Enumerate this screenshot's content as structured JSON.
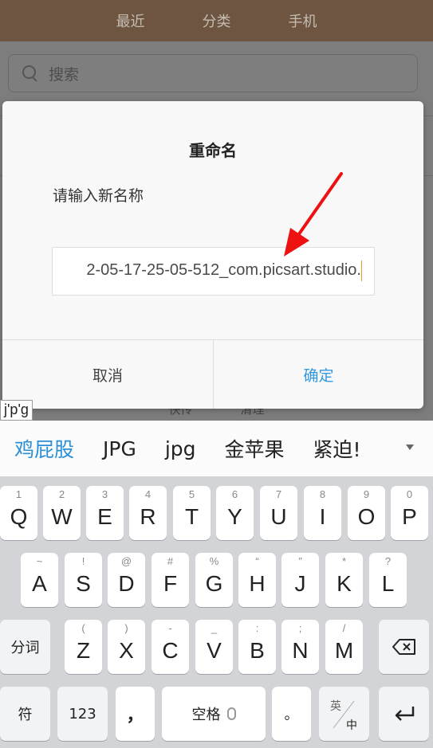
{
  "topbar": {
    "tabs": [
      "最近",
      "分类",
      "手机"
    ]
  },
  "search": {
    "placeholder": "搜索"
  },
  "background": {
    "bottom_labels": [
      "快传",
      "清理"
    ]
  },
  "dialog": {
    "title": "重命名",
    "prompt": "请输入新名称",
    "input_value": "2-05-17-25-05-512_com.picsart.studio.",
    "cancel_label": "取消",
    "ok_label": "确定"
  },
  "ime": {
    "composition": "j'p'g",
    "candidates": [
      "鸡屁股",
      "JPG",
      "jpg",
      "金苹果",
      "紧迫!"
    ]
  },
  "keyboard": {
    "row1": [
      {
        "main": "Q",
        "sub": "1"
      },
      {
        "main": "W",
        "sub": "2"
      },
      {
        "main": "E",
        "sub": "3"
      },
      {
        "main": "R",
        "sub": "4"
      },
      {
        "main": "T",
        "sub": "5"
      },
      {
        "main": "Y",
        "sub": "6"
      },
      {
        "main": "U",
        "sub": "7"
      },
      {
        "main": "I",
        "sub": "8"
      },
      {
        "main": "O",
        "sub": "9"
      },
      {
        "main": "P",
        "sub": "0"
      }
    ],
    "row2": [
      {
        "main": "A",
        "sub": "~"
      },
      {
        "main": "S",
        "sub": "!"
      },
      {
        "main": "D",
        "sub": "@"
      },
      {
        "main": "F",
        "sub": "#"
      },
      {
        "main": "G",
        "sub": "%"
      },
      {
        "main": "H",
        "sub": "“"
      },
      {
        "main": "J",
        "sub": "”"
      },
      {
        "main": "K",
        "sub": "*"
      },
      {
        "main": "L",
        "sub": "?"
      }
    ],
    "row3": [
      {
        "main": "Z",
        "sub": "("
      },
      {
        "main": "X",
        "sub": ")"
      },
      {
        "main": "C",
        "sub": "-"
      },
      {
        "main": "V",
        "sub": "_"
      },
      {
        "main": "B",
        "sub": ":"
      },
      {
        "main": "N",
        "sub": ";"
      },
      {
        "main": "M",
        "sub": "/"
      }
    ],
    "segment_label": "分词",
    "symbol_label": "符",
    "number_label": "123",
    "comma_label": "，",
    "space_label": "空格",
    "period_label": "。",
    "lang_top": "英",
    "lang_bottom": "中"
  },
  "colors": {
    "accent": "#3399dd",
    "topbar": "#6d5541",
    "arrow": "#ee1111"
  }
}
